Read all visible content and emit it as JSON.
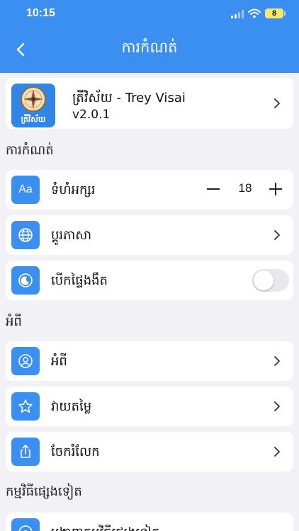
{
  "status_bar": {
    "time": "10:15",
    "battery_level": "8"
  },
  "header": {
    "title": "ការកំណត់"
  },
  "app_card": {
    "name": "ត្រីវិស័យ - Trey Visai",
    "version": "v2.0.1",
    "icon_text": "ត្រីវិស័យ"
  },
  "sections": {
    "settings": "ការកំណត់",
    "about": "អំពី",
    "other_apps": "កម្មវិធីផ្សេងទៀត"
  },
  "settings_items": {
    "font_size": {
      "label": "ទំហំអក្សរ",
      "icon_text": "Aa",
      "value": "18"
    },
    "language": {
      "label": "ប្តូរភាសា"
    },
    "dark_mode": {
      "label": "បើកផ្ទៃងងឹត",
      "enabled": false
    }
  },
  "about_items": {
    "about": {
      "label": "អំពី"
    },
    "rate": {
      "label": "វាយតម្លៃ"
    },
    "share": {
      "label": "ចែករំលែក"
    }
  },
  "other_items": {
    "more_apps": {
      "label": "បង្ហាញកម្មវិធីផ្សេងទៀត"
    }
  },
  "colors": {
    "accent": "#3b8ff1",
    "background": "#f2f2f6",
    "card": "#ffffff"
  },
  "icons": [
    "chevron-left-icon",
    "text-size-icon",
    "globe-icon",
    "moon-icon",
    "user-circle-icon",
    "star-icon",
    "share-icon",
    "chevron-right-icon",
    "compass-icon"
  ]
}
